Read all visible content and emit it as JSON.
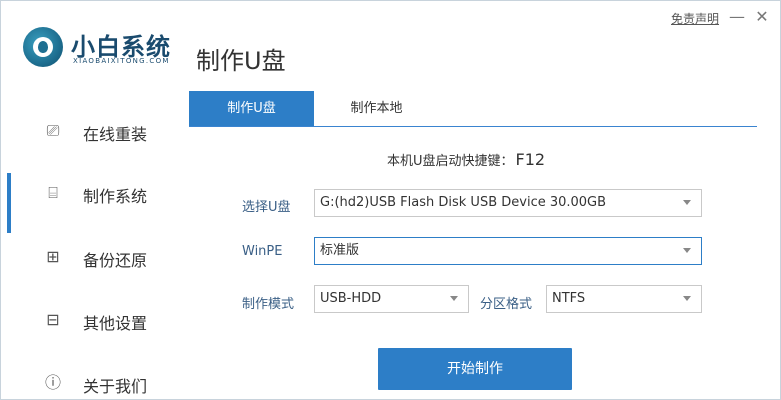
{
  "window": {
    "disclaimer": "免责声明",
    "minimize": "—",
    "close": "✕"
  },
  "logo": {
    "name": "小白系统",
    "subtitle": "XIAOBAIXITONG.COM"
  },
  "page_title": "制作U盘",
  "sidebar": {
    "items": [
      {
        "label": "在线重装",
        "icon": "monitor-icon",
        "glyph": "⎚",
        "active": false
      },
      {
        "label": "制作系统",
        "icon": "usb-drive-icon",
        "glyph": "⌸",
        "active": true
      },
      {
        "label": "备份还原",
        "icon": "backup-grid-icon",
        "glyph": "⊞",
        "active": false
      },
      {
        "label": "其他设置",
        "icon": "briefcase-icon",
        "glyph": "⊟",
        "active": false
      },
      {
        "label": "关于我们",
        "icon": "info-icon",
        "glyph": "ⓘ",
        "active": false
      }
    ]
  },
  "tabs": [
    {
      "label": "制作U盘",
      "active": true
    },
    {
      "label": "制作本地",
      "active": false
    }
  ],
  "hotkey": {
    "label": "本机U盘启动快捷键：",
    "key": "F12"
  },
  "form": {
    "usb_label": "选择U盘",
    "usb_value": "G:(hd2)USB Flash Disk USB Device 30.00GB",
    "winpe_label": "WinPE",
    "winpe_value": "标准版",
    "mode_label": "制作模式",
    "mode_value": "USB-HDD",
    "partition_label": "分区格式",
    "partition_value": "NTFS"
  },
  "start_button": "开始制作",
  "colors": {
    "accent": "#2d7ec7",
    "logo_text": "#1a4b6e"
  }
}
